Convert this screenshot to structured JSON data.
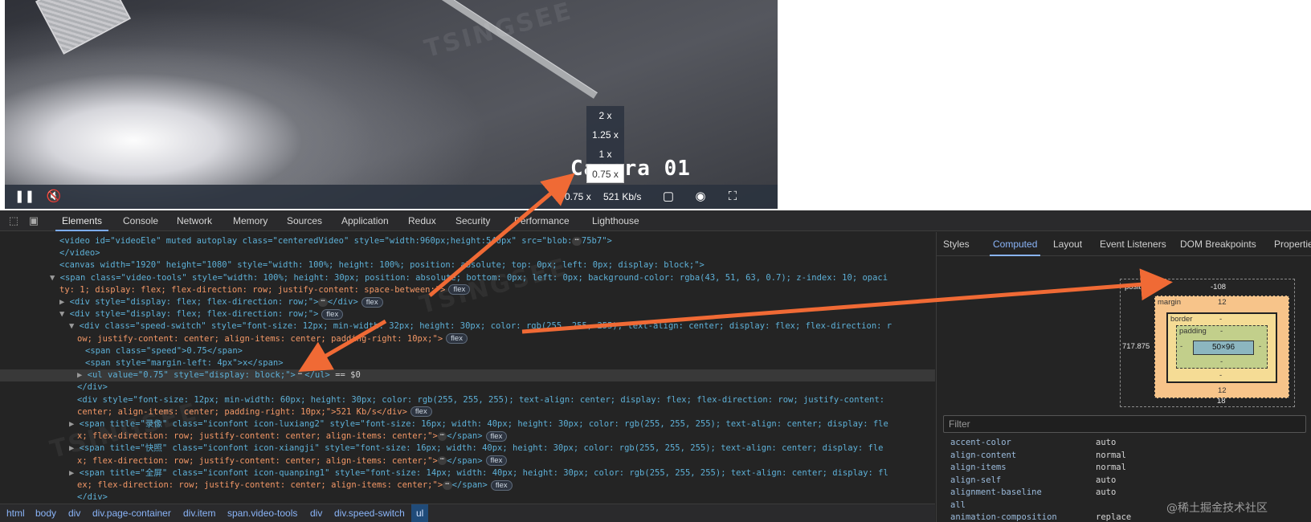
{
  "video": {
    "camera_label": "Camera 01",
    "watermark": "TSINGSEE",
    "speed_options": [
      "2 x",
      "1.25 x",
      "1 x",
      "0.75 x"
    ],
    "selected_speed": "0.75 x",
    "speed_readout": "0.75 x",
    "bitrate": "521 Kb/s",
    "icons": [
      "pause-icon",
      "mute-icon",
      "record-icon",
      "snapshot-icon",
      "fullscreen-icon"
    ]
  },
  "devtools": {
    "tabs": [
      "Elements",
      "Console",
      "Network",
      "Memory",
      "Sources",
      "Application",
      "Redux",
      "Security",
      "Performance",
      "Lighthouse"
    ],
    "active_tab": "Elements",
    "side_tabs": [
      "Styles",
      "Computed",
      "Layout",
      "Event Listeners",
      "DOM Breakpoints",
      "Properties"
    ],
    "active_side_tab": "Computed",
    "breadcrumbs": [
      "html",
      "body",
      "div",
      "div.page-container",
      "div.item",
      "span.video-tools",
      "div",
      "div.speed-switch",
      "ul"
    ],
    "selected_crumb": "ul",
    "dom_lines": [
      {
        "t": "<video id=\"videoEle\" muted autoplay class=\"centeredVideo\" style=\"width:960px;height:540px\" src=\"blob:",
        "tail": "75b7\">"
      },
      {
        "t": "</video>"
      },
      {
        "t": "<canvas width=\"1920\" height=\"1080\" style=\"width: 100%; height: 100%; position: absolute; top: 0px; left: 0px; display: block;\">"
      },
      {
        "t": "<span class=\"video-tools\" style=\"width: 100%; height: 30px; position: absolute; bottom: 0px; left: 0px; background-color: rgba(43, 51, 63, 0.7); z-index: 10; opaci"
      },
      {
        "t": "ty: 1; display: flex; flex-direction: row; justify-content: space-between;\">",
        "badge": "flex"
      },
      {
        "t": "<div style=\"display: flex; flex-direction: row;\">",
        "tail": "</div>",
        "badge": "flex"
      },
      {
        "t": "<div style=\"display: flex; flex-direction: row;\">",
        "badge": "flex"
      },
      {
        "t": "<div class=\"speed-switch\" style=\"font-size: 12px; min-width: 32px; height: 30px; color: rgb(255, 255, 255); text-align: center; display: flex; flex-direction: r"
      },
      {
        "t": "ow; justify-content: center; align-items: center; padding-right: 10px;\">",
        "badge": "flex"
      },
      {
        "t": "<span class=\"speed\">0.75</span>"
      },
      {
        "t": "<span style=\"margin-left: 4px\">x</span>"
      },
      {
        "t": "<ul value=\"0.75\" style=\"display: block;\">",
        "tail": "</ul>",
        "suffix": " == $0"
      },
      {
        "t": "</div>"
      },
      {
        "t": "<div style=\"font-size: 12px; min-width: 60px; height: 30px; color: rgb(255, 255, 255); text-align: center; display: flex; flex-direction: row; justify-content:"
      },
      {
        "t": "center; align-items: center; padding-right: 10px;\">521 Kb/s</div>",
        "badge": "flex"
      },
      {
        "t": "<span title=\"录像\" class=\"iconfont icon-luxiang2\" style=\"font-size: 16px; width: 40px; height: 30px; color: rgb(255, 255, 255); text-align: center; display: fle"
      },
      {
        "t": "x; flex-direction: row; justify-content: center; align-items: center;\">",
        "tail": "</span>",
        "badge": "flex"
      },
      {
        "t": "<span title=\"快照\" class=\"iconfont icon-xiangji\" style=\"font-size: 16px; width: 40px; height: 30px; color: rgb(255, 255, 255); text-align: center; display: fle"
      },
      {
        "t": "x; flex-direction: row; justify-content: center; align-items: center;\">",
        "tail": "</span>",
        "badge": "flex"
      },
      {
        "t": "<span title=\"全屏\" class=\"iconfont icon-quanping1\" style=\"font-size: 14px; width: 40px; height: 30px; color: rgb(255, 255, 255); text-align: center; display: fl"
      },
      {
        "t": "ex; flex-direction: row; justify-content: center; align-items: center;\">",
        "tail": "</span>",
        "badge": "flex"
      },
      {
        "t": "</div>"
      }
    ],
    "box_model": {
      "position_label": "position",
      "position_top": "-108",
      "position_left": "717.875",
      "position_bottom": "18",
      "margin_label": "margin",
      "margin_top": "12",
      "margin_bottom": "12",
      "border_label": "border",
      "border_top": "-",
      "border_bottom": "-",
      "padding_label": "padding",
      "padding_top": "-",
      "padding_bottom": "-",
      "padding_left": "-",
      "padding_right": "-",
      "content": "50×96",
      "dash": "-"
    },
    "filter_placeholder": "Filter",
    "computed_props": [
      {
        "name": "accent-color",
        "value": "auto"
      },
      {
        "name": "align-content",
        "value": "normal"
      },
      {
        "name": "align-items",
        "value": "normal"
      },
      {
        "name": "align-self",
        "value": "auto"
      },
      {
        "name": "alignment-baseline",
        "value": "auto"
      },
      {
        "name": "all",
        "value": ""
      },
      {
        "name": "animation-composition",
        "value": "replace"
      }
    ]
  },
  "credit": "@稀土掘金技术社区",
  "colors": {
    "arrow": "#f06a35",
    "selected_tab": "#8ab4f8"
  }
}
